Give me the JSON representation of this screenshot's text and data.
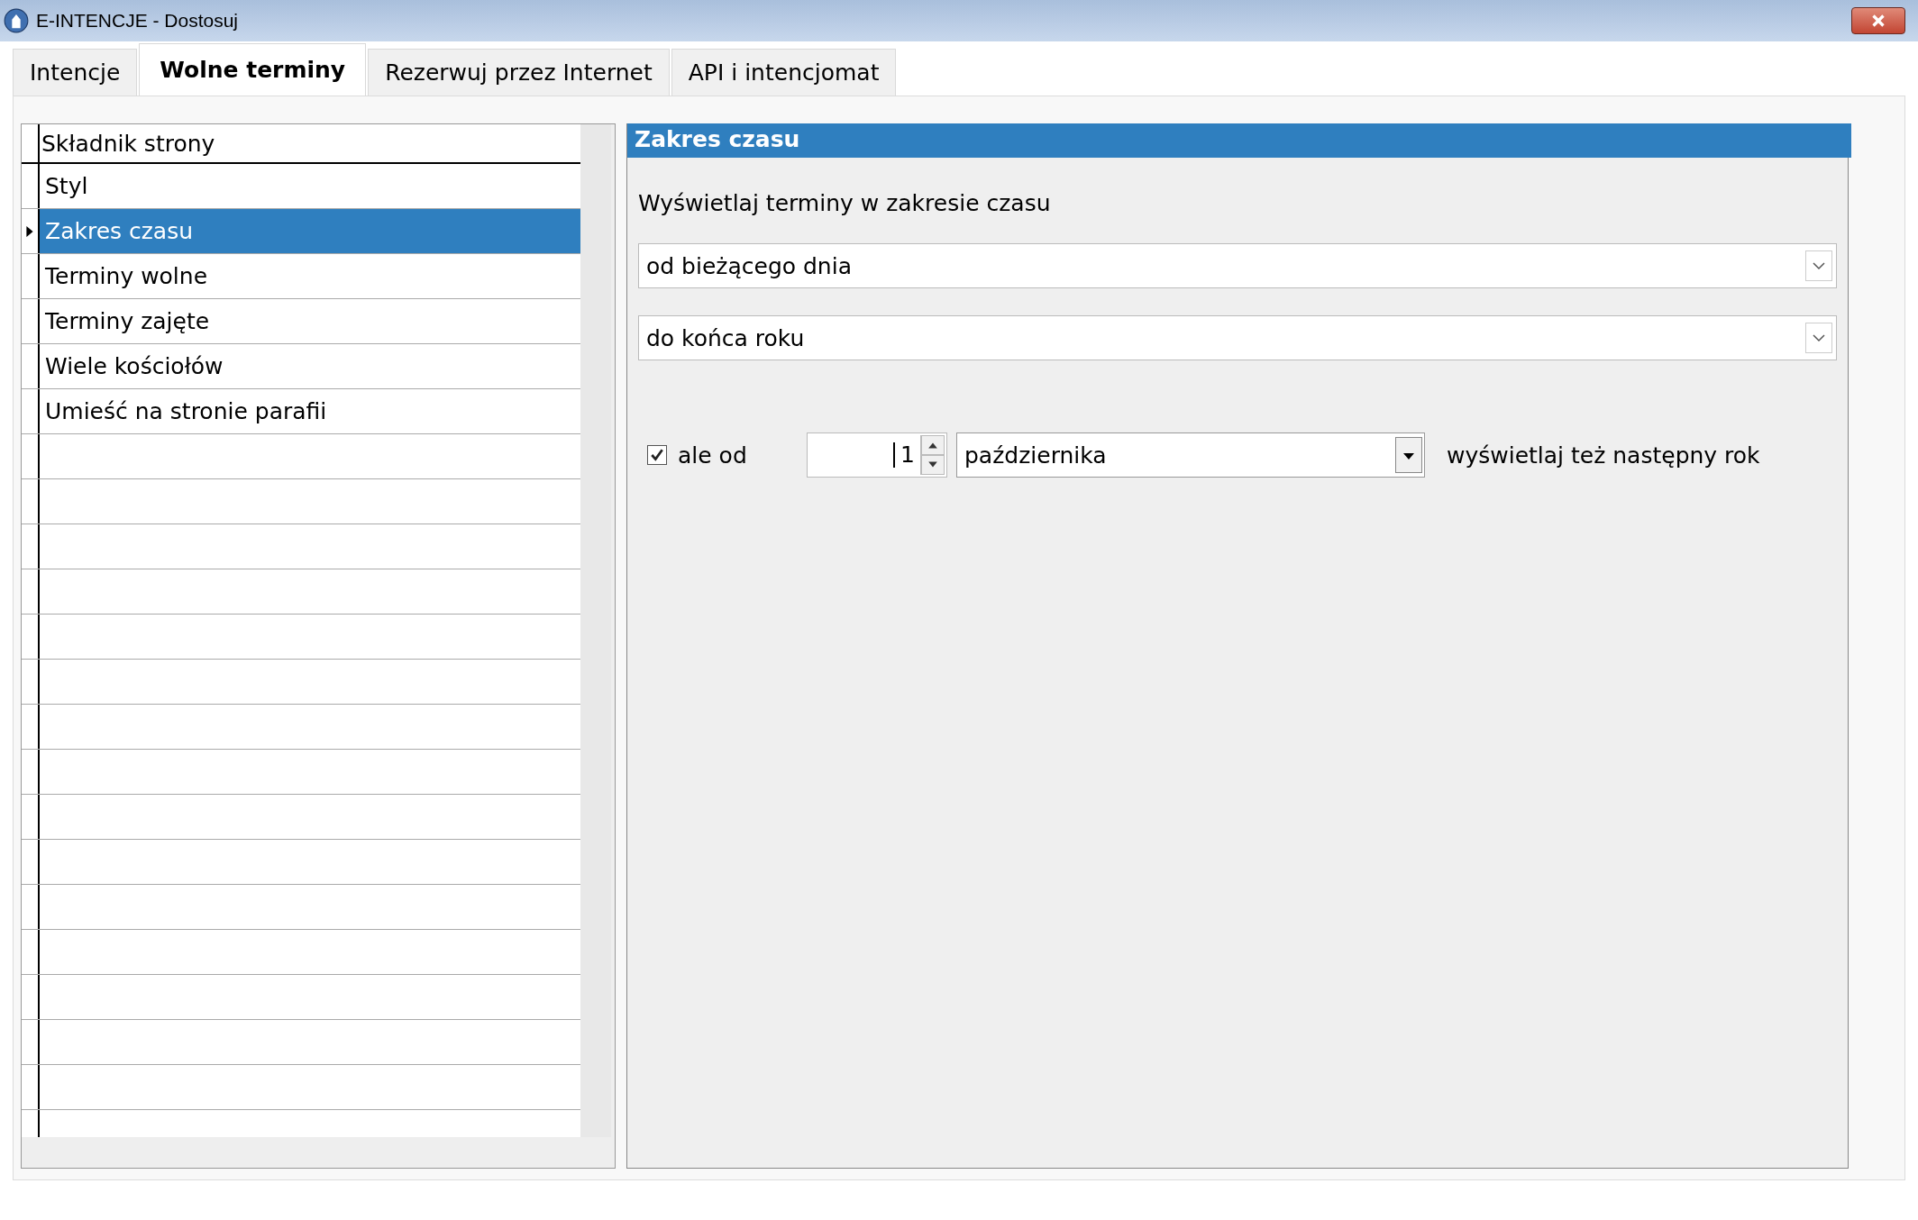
{
  "window": {
    "title": "E-INTENCJE - Dostosuj"
  },
  "tabs": [
    {
      "label": "Intencje",
      "selected": false
    },
    {
      "label": "Wolne terminy",
      "selected": true
    },
    {
      "label": "Rezerwuj przez Internet",
      "selected": false
    },
    {
      "label": "API i intencjomat",
      "selected": false
    }
  ],
  "grid": {
    "header": "Składnik strony",
    "rows": [
      {
        "label": "Styl",
        "selected": false
      },
      {
        "label": "Zakres czasu",
        "selected": true
      },
      {
        "label": "Terminy wolne",
        "selected": false
      },
      {
        "label": "Terminy zajęte",
        "selected": false
      },
      {
        "label": "Wiele kościołów",
        "selected": false
      },
      {
        "label": "Umieść na stronie parafii",
        "selected": false
      }
    ]
  },
  "panel": {
    "title": "Zakres czasu",
    "prompt": "Wyświetlaj terminy w zakresie czasu",
    "from_select": "od bieżącego dnia",
    "to_select": "do końca roku",
    "but_from": {
      "checked": true,
      "label": "ale od",
      "day": "1",
      "month": "października",
      "suffix": "wyświetlaj też następny rok"
    }
  }
}
